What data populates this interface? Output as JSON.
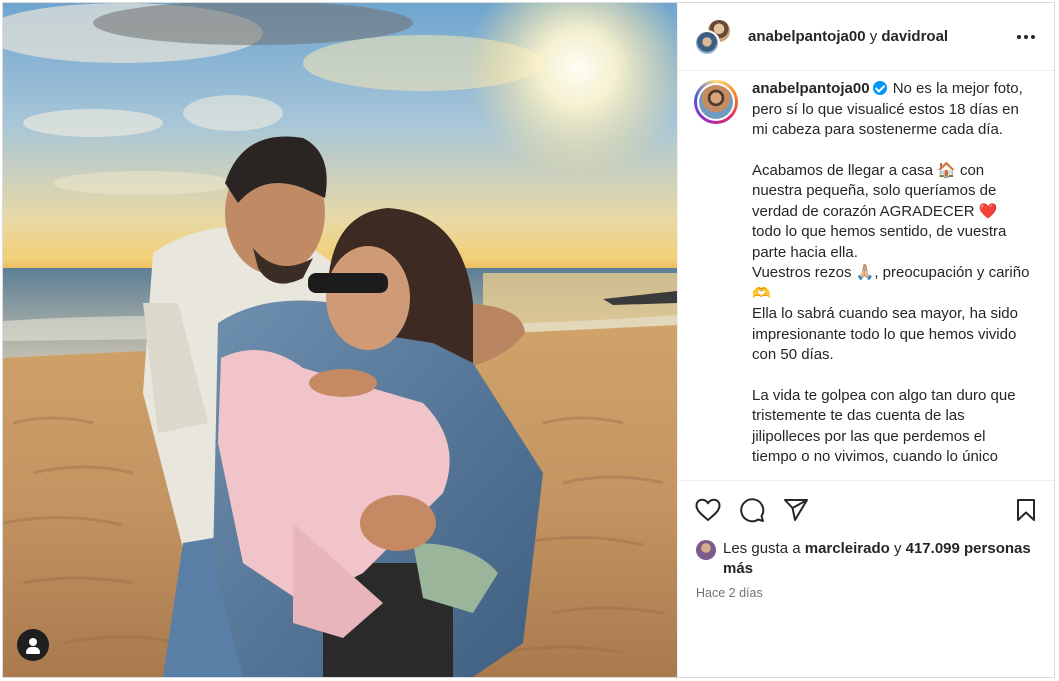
{
  "header": {
    "username": "anabelpantoja00",
    "coauthor_connector": "y",
    "coauthor": "davidroal",
    "more_icon": "more-horizontal-icon"
  },
  "caption": {
    "username": "anabelpantoja00",
    "verified": true,
    "paragraph_1": "No es la mejor foto, pero sí lo que visualicé estos 18 días en mi cabeza para sostenerme cada día.",
    "paragraph_2_a": "Acabamos de llegar a casa 🏠 con nuestra pequeña, solo queríamos de verdad de corazón AGRADECER ❤️ todo lo que hemos sentido, de vuestra parte hacia ella.",
    "paragraph_2_b": "Vuestros rezos 🙏🏼, preocupación y cariño 🫶",
    "paragraph_2_c": "Ella lo sabrá cuando sea mayor, ha sido impresionante todo lo que hemos vivido con 50 días.",
    "paragraph_3": "La vida te golpea con algo tan duro que tristemente te das cuenta de las jilipolleces por las que perdemos el tiempo o no vivimos, cuando lo único"
  },
  "actions": {
    "like_icon": "heart-icon",
    "comment_icon": "comment-icon",
    "share_icon": "share-icon",
    "save_icon": "bookmark-icon"
  },
  "likes": {
    "prefix": "Les gusta a",
    "liker": "marcleirado",
    "connector": "y",
    "count": "417.099 personas más"
  },
  "timestamp": "Hace 2 días",
  "photo": {
    "user_tag_icon": "user-icon"
  }
}
